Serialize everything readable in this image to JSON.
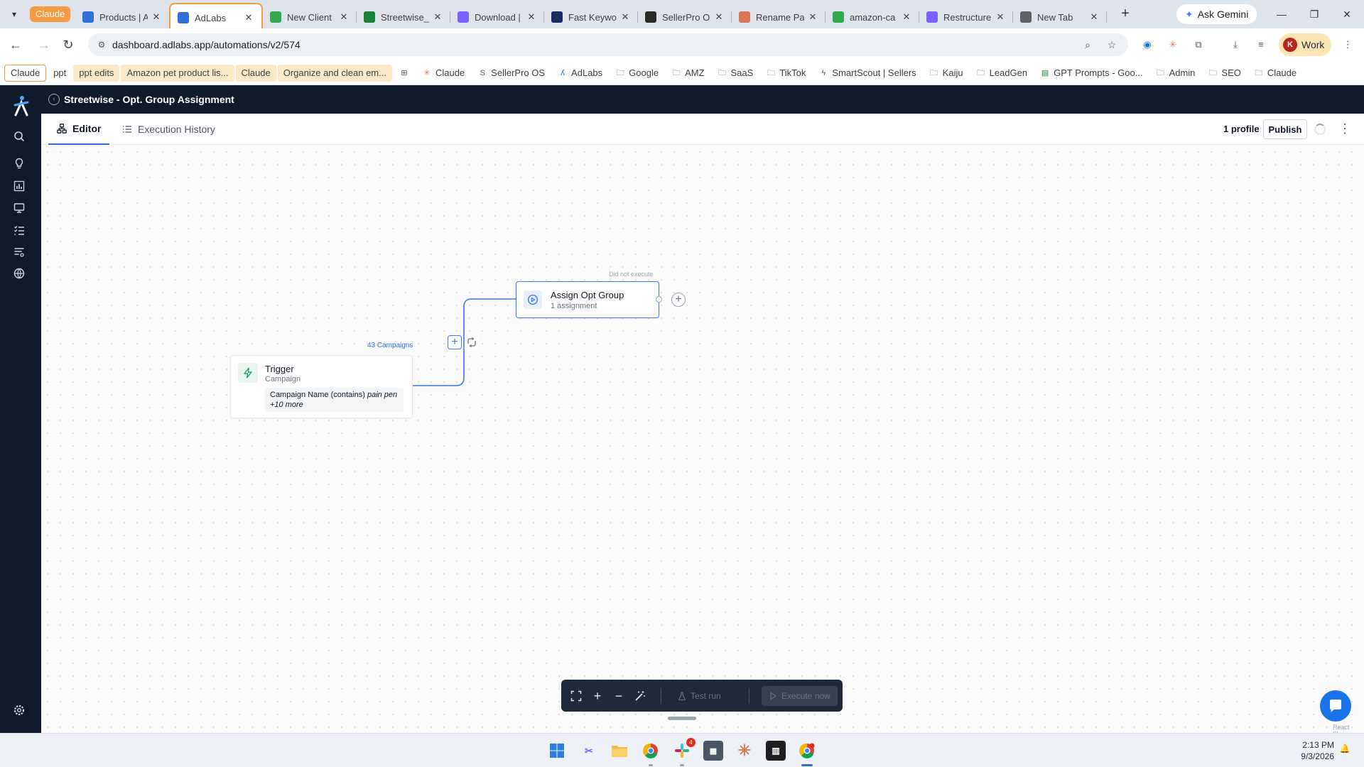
{
  "browser": {
    "tab_group_label": "Claude",
    "tabs": [
      {
        "title": "Products | A",
        "favicon": "adlabs-icon",
        "color": "#2f6fd6"
      },
      {
        "title": "AdLabs",
        "favicon": "adlabs-icon",
        "color": "#2f6fd6",
        "active": true
      },
      {
        "title": "New Client",
        "favicon": "google-drive-icon",
        "color": "#34a853"
      },
      {
        "title": "Streetwise_",
        "favicon": "google-sheets-icon",
        "color": "#188038"
      },
      {
        "title": "Download |",
        "favicon": "g-icon",
        "color": "#7b61ff"
      },
      {
        "title": "Fast Keywor",
        "favicon": "k-icon",
        "color": "#1a2b5e"
      },
      {
        "title": "SellerPro O",
        "favicon": "sellerpro-icon",
        "color": "#2b2b2b"
      },
      {
        "title": "Rename Pa",
        "favicon": "claude-icon",
        "color": "#d97757"
      },
      {
        "title": "amazon-ca",
        "favicon": "google-drive-icon",
        "color": "#34a853"
      },
      {
        "title": "Restructure",
        "favicon": "g-icon",
        "color": "#7b61ff"
      },
      {
        "title": "New Tab",
        "favicon": "chrome-icon",
        "color": "#5f6368"
      }
    ],
    "gemini_label": "Ask Gemini",
    "url": "dashboard.adlabs.app/automations/v2/574",
    "profile_initial": "K",
    "profile_label": "Work"
  },
  "bookmarks": [
    {
      "label": "Claude",
      "style": "pill-out"
    },
    {
      "label": "ppt",
      "style": "plain"
    },
    {
      "label": "ppt edits",
      "style": "pill"
    },
    {
      "label": "Amazon pet product lis...",
      "style": "pill"
    },
    {
      "label": "Claude",
      "style": "pill"
    },
    {
      "label": "Organize and clean em...",
      "style": "pill"
    },
    {
      "label": "",
      "style": "apps",
      "icon": "apps-grid-icon"
    },
    {
      "label": "Claude",
      "style": "plain",
      "icon": "claude-icon"
    },
    {
      "label": "SellerPro OS",
      "style": "plain",
      "icon": "sellerpro-icon"
    },
    {
      "label": "AdLabs",
      "style": "plain",
      "icon": "adlabs-icon"
    },
    {
      "label": "Google",
      "style": "plain",
      "icon": "folder-icon"
    },
    {
      "label": "AMZ",
      "style": "plain",
      "icon": "folder-icon"
    },
    {
      "label": "SaaS",
      "style": "plain",
      "icon": "folder-icon"
    },
    {
      "label": "TikTok",
      "style": "plain",
      "icon": "folder-icon"
    },
    {
      "label": "SmartScout | Sellers",
      "style": "plain",
      "icon": "smartscout-icon"
    },
    {
      "label": "Kaiju",
      "style": "plain",
      "icon": "folder-icon"
    },
    {
      "label": "LeadGen",
      "style": "plain",
      "icon": "folder-icon"
    },
    {
      "label": "GPT Prompts - Goo...",
      "style": "plain",
      "icon": "google-sheets-icon"
    },
    {
      "label": "Admin",
      "style": "plain",
      "icon": "folder-icon"
    },
    {
      "label": "SEO",
      "style": "plain",
      "icon": "folder-icon"
    },
    {
      "label": "Claude",
      "style": "plain",
      "icon": "folder-icon"
    }
  ],
  "app": {
    "automation_name": "Streetwise - Opt. Group Assignment",
    "tabs": {
      "editor": "Editor",
      "history": "Execution History"
    },
    "profiles": "1 profile",
    "publish": "Publish",
    "sidebar_icons": [
      "search-icon",
      "lightbulb-icon",
      "bar-chart-icon",
      "monitor-icon",
      "checklist-icon",
      "list-filter-icon",
      "globe-icon",
      "settings-icon"
    ]
  },
  "flow": {
    "trigger": {
      "title": "Trigger",
      "subtitle": "Campaign",
      "condition_prefix": "Campaign Name (contains)",
      "condition_value": "pain pen",
      "more": "+10 more"
    },
    "edge_label": "43 Campaigns",
    "action": {
      "status": "Did not execute",
      "title": "Assign Opt Group",
      "subtitle": "1 assignment"
    }
  },
  "controls": {
    "test_run": "Test run",
    "execute_now": "Execute now"
  },
  "attribution": "React Flow",
  "taskbar": {
    "time": "2:13 PM",
    "date": "9/3/2026",
    "badge_count": "4"
  },
  "colors": {
    "accent": "#3b7be8",
    "sidebar_bg": "#0f1b2d",
    "trigger_icon": "#22a06b",
    "tab_group": "#f59b42"
  }
}
